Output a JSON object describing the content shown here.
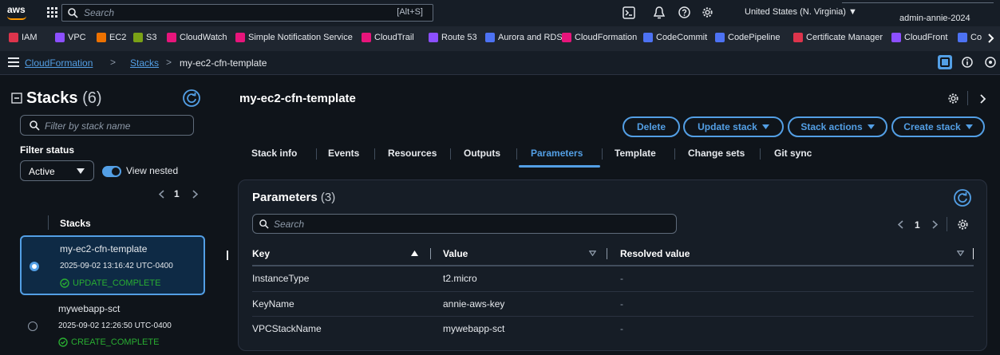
{
  "topbar": {
    "logo": "aws",
    "search_placeholder": "Search",
    "search_shortcut": "[Alt+S]",
    "region": "United States (N. Virginia) ▼",
    "user": "admin-annie-2024"
  },
  "favorites": [
    {
      "label": "IAM",
      "color": "#dd344c"
    },
    {
      "label": "VPC",
      "color": "#8c4fff"
    },
    {
      "label": "EC2",
      "color": "#ed7100"
    },
    {
      "label": "S3",
      "color": "#7aa116"
    },
    {
      "label": "CloudWatch",
      "color": "#e7157b"
    },
    {
      "label": "Simple Notification Service",
      "color": "#e7157b"
    },
    {
      "label": "CloudTrail",
      "color": "#e7157b"
    },
    {
      "label": "Route 53",
      "color": "#8c4fff"
    },
    {
      "label": "Aurora and RDS",
      "color": "#4d72f3"
    },
    {
      "label": "CloudFormation",
      "color": "#e7157b"
    },
    {
      "label": "CodeCommit",
      "color": "#4d72f3"
    },
    {
      "label": "CodePipeline",
      "color": "#4d72f3"
    },
    {
      "label": "Certificate Manager",
      "color": "#dd344c"
    },
    {
      "label": "CloudFront",
      "color": "#8c4fff"
    },
    {
      "label": "Co",
      "color": "#4d72f3"
    }
  ],
  "breadcrumb": {
    "root": "CloudFormation",
    "stacks": "Stacks",
    "current": "my-ec2-cfn-template",
    "sep": ">"
  },
  "left": {
    "title": "Stacks",
    "count": "(6)",
    "filter_placeholder": "Filter by stack name",
    "filter_status_label": "Filter status",
    "status_value": "Active",
    "view_nested": "View nested",
    "page": "1",
    "column_header": "Stacks",
    "stacks": [
      {
        "name": "my-ec2-cfn-template",
        "date": "2025-09-02 13:16:42 UTC-0400",
        "status": "UPDATE_COMPLETE"
      },
      {
        "name": "mywebapp-sct",
        "date": "2025-09-02 12:26:50 UTC-0400",
        "status": "CREATE_COMPLETE"
      }
    ]
  },
  "main": {
    "stack_title": "my-ec2-cfn-template",
    "buttons": {
      "delete": "Delete",
      "update": "Update stack",
      "actions": "Stack actions",
      "create": "Create stack"
    },
    "tabs": [
      "Stack info",
      "Events",
      "Resources",
      "Outputs",
      "Parameters",
      "Template",
      "Change sets",
      "Git sync"
    ],
    "active_tab": "Parameters"
  },
  "params": {
    "title": "Parameters",
    "count": "(3)",
    "search_placeholder": "Search",
    "page": "1",
    "columns": {
      "key": "Key",
      "value": "Value",
      "resolved": "Resolved value"
    },
    "rows": [
      {
        "key": "InstanceType",
        "value": "t2.micro",
        "resolved": "-"
      },
      {
        "key": "KeyName",
        "value": "annie-aws-key",
        "resolved": "-"
      },
      {
        "key": "VPCStackName",
        "value": "mywebapp-sct",
        "resolved": "-"
      }
    ]
  },
  "colors": {
    "accent": "#539fe5",
    "success": "#29ad32",
    "aws_orange": "#ff9900"
  }
}
